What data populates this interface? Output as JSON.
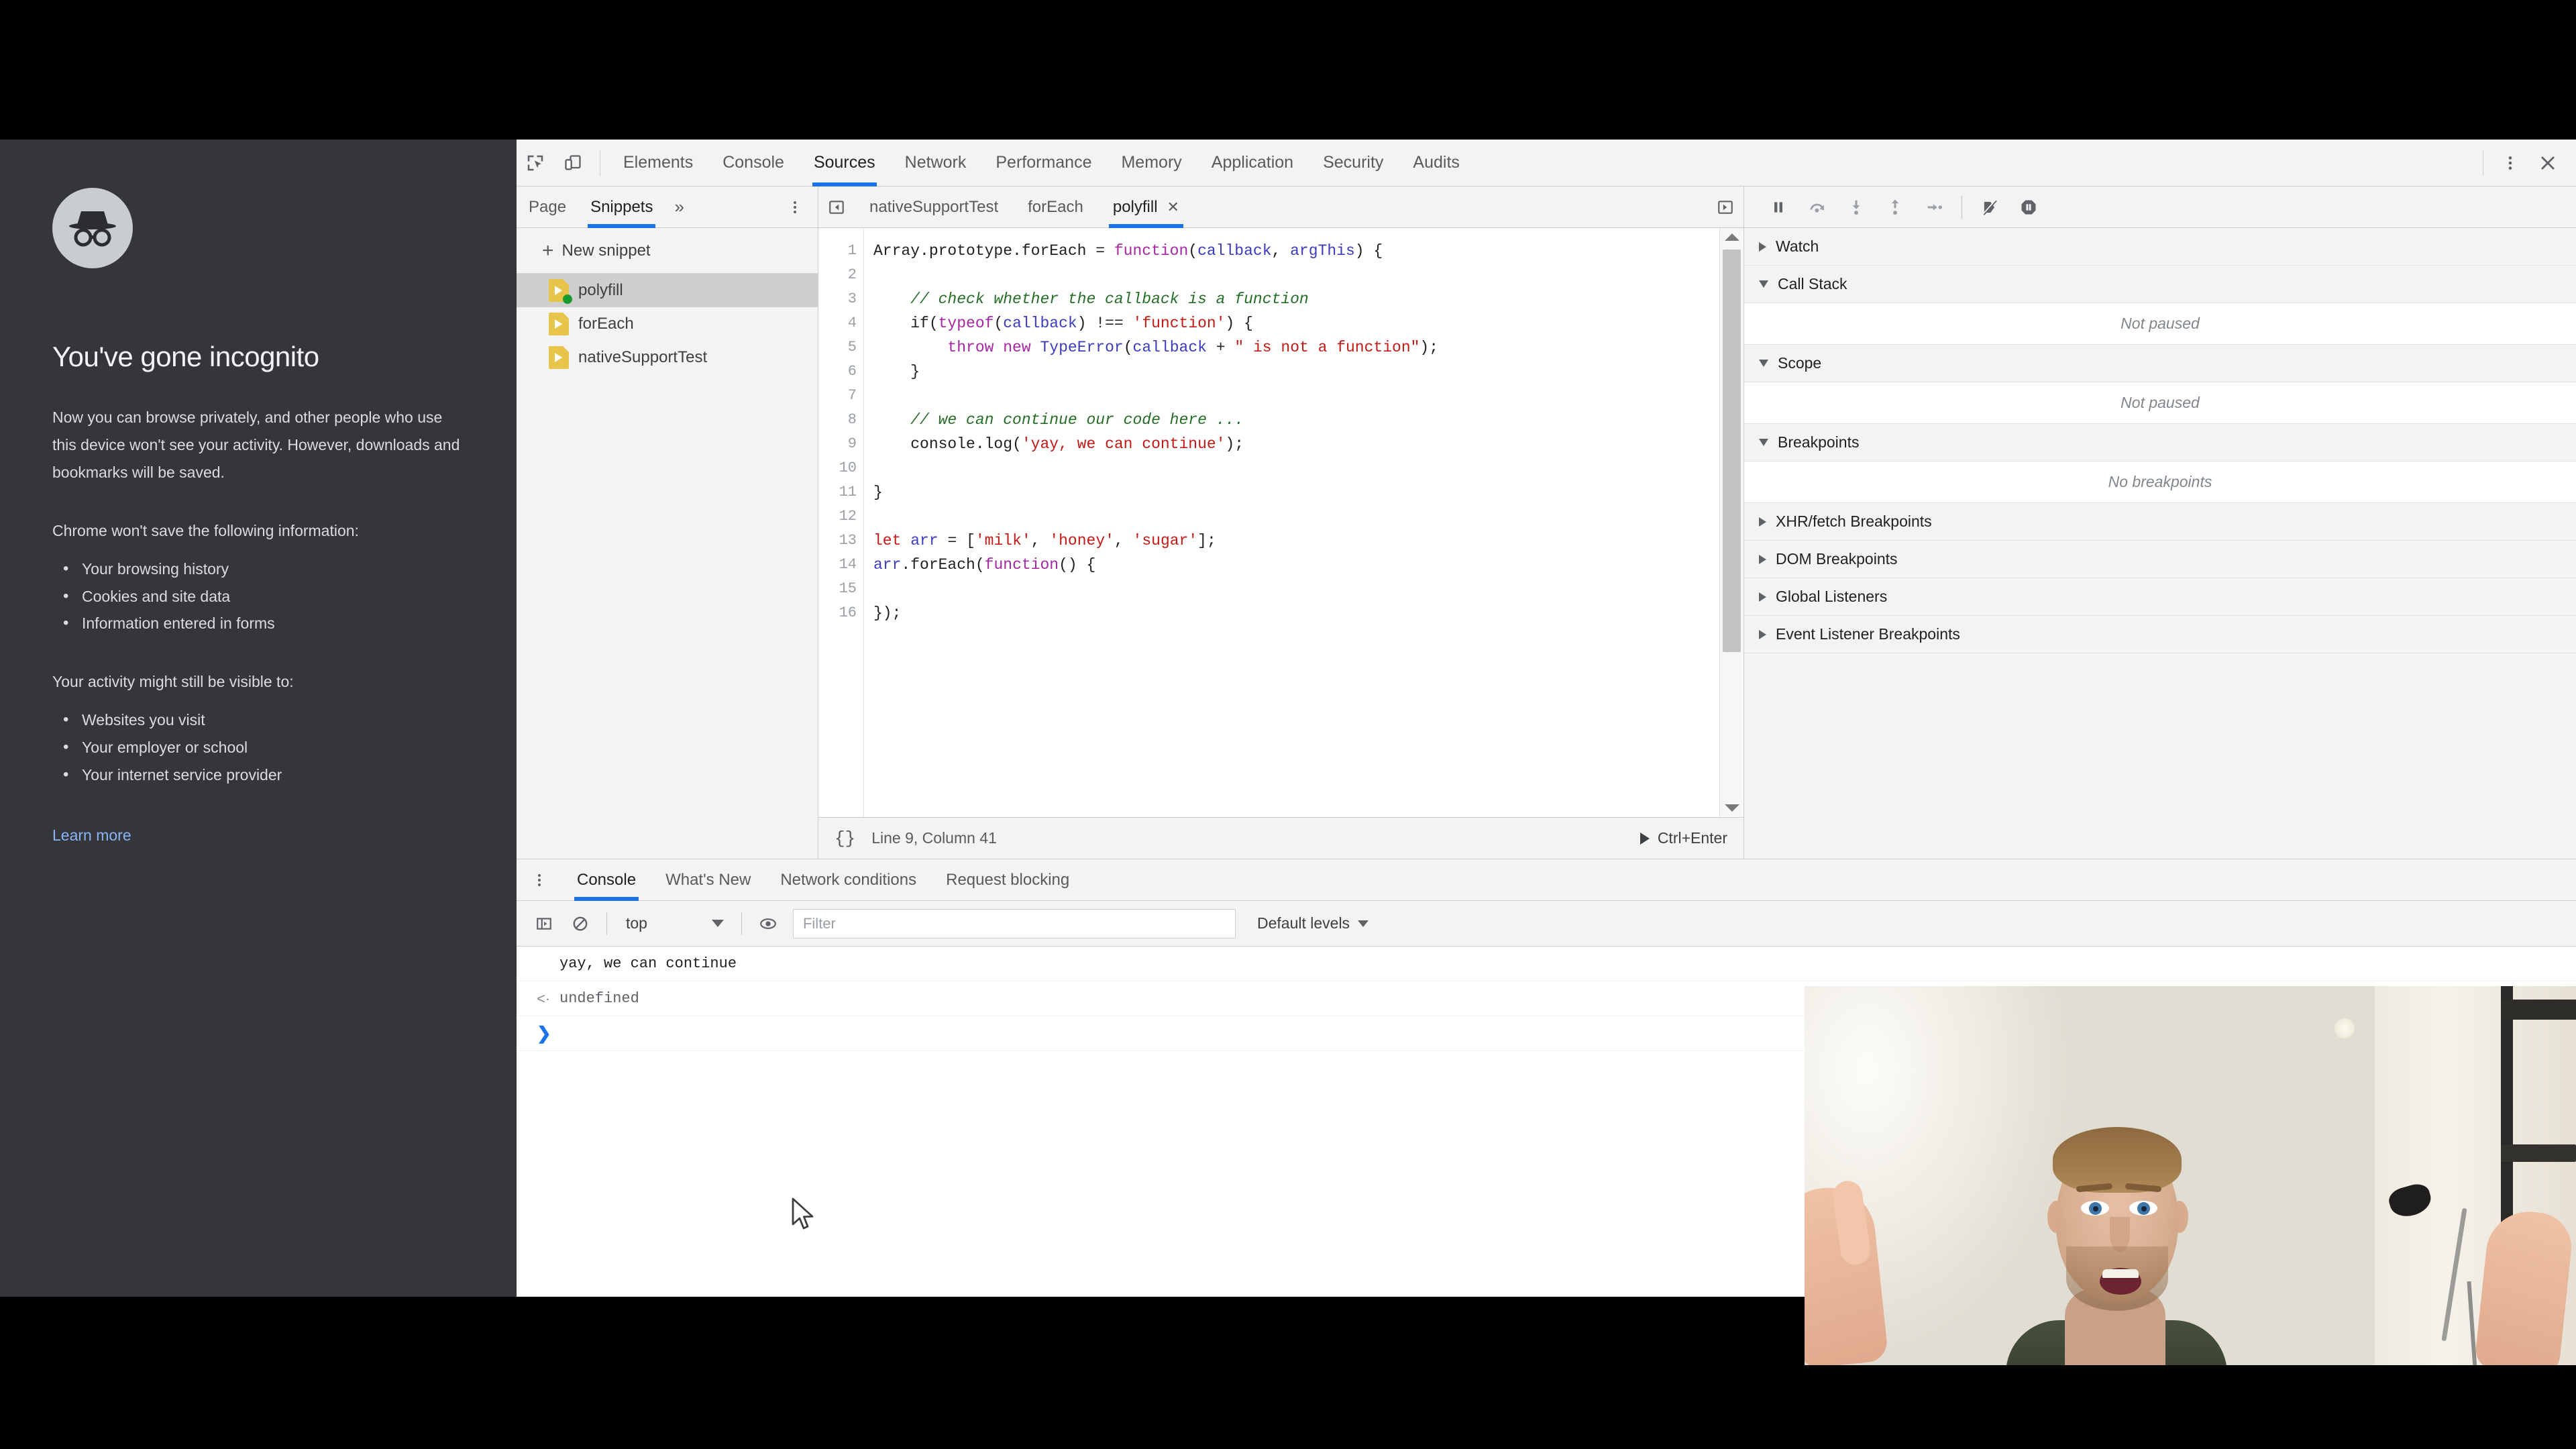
{
  "incognito": {
    "avatar_icon": "incognito-spy-icon",
    "title": "You've gone incognito",
    "paragraph": "Now you can browse privately, and other people who use this device won't see your activity. However, downloads and bookmarks will be saved.",
    "wont_save_heading": "Chrome won't save the following information:",
    "wont_save_items": [
      "Your browsing history",
      "Cookies and site data",
      "Information entered in forms"
    ],
    "visible_heading": "Your activity might still be visible to:",
    "visible_items": [
      "Websites you visit",
      "Your employer or school",
      "Your internet service provider"
    ],
    "learn_more": "Learn more",
    "link_color": "#8ab4f8",
    "background_color": "#35363a"
  },
  "devtools": {
    "accent_color": "#1a73e8",
    "toolbar": {
      "inspect_icon": "inspect-element-icon",
      "device_icon": "device-toolbar-icon",
      "more_icon": "kebab-menu-icon",
      "close_icon": "close-icon",
      "tabs": [
        {
          "label": "Elements",
          "active": false
        },
        {
          "label": "Console",
          "active": false
        },
        {
          "label": "Sources",
          "active": true
        },
        {
          "label": "Network",
          "active": false
        },
        {
          "label": "Performance",
          "active": false
        },
        {
          "label": "Memory",
          "active": false
        },
        {
          "label": "Application",
          "active": false
        },
        {
          "label": "Security",
          "active": false
        },
        {
          "label": "Audits",
          "active": false
        }
      ]
    },
    "navigator": {
      "tabs": [
        {
          "label": "Page",
          "active": false
        },
        {
          "label": "Snippets",
          "active": true
        }
      ],
      "more_tabs_icon": "chevron-double-right-icon",
      "kebab_icon": "kebab-menu-icon",
      "new_snippet_label": "New snippet",
      "new_snippet_icon": "plus-icon",
      "snippets": [
        {
          "name": "polyfill",
          "selected": true,
          "running": true
        },
        {
          "name": "forEach",
          "selected": false,
          "running": false
        },
        {
          "name": "nativeSupportTest",
          "selected": false,
          "running": false
        }
      ]
    },
    "editor": {
      "prev_icon": "panel-collapse-left-icon",
      "next_icon": "panel-collapse-right-icon",
      "tabs": [
        {
          "label": "nativeSupportTest",
          "active": false,
          "closable": false
        },
        {
          "label": "forEach",
          "active": false,
          "closable": false
        },
        {
          "label": "polyfill",
          "active": true,
          "closable": true
        }
      ],
      "close_tab_icon": "close-icon",
      "line_numbers": [
        "1",
        "2",
        "3",
        "4",
        "5",
        "6",
        "7",
        "8",
        "9",
        "10",
        "11",
        "12",
        "13",
        "14",
        "15",
        "16"
      ],
      "code_lines": [
        "Array.prototype.forEach = function(callback, argThis) {",
        "",
        "    // check whether the callback is a function",
        "    if(typeof(callback) !== 'function') {",
        "        throw new TypeError(callback + \" is not a function\");",
        "    }",
        "",
        "    // we can continue our code here ...",
        "    console.log('yay, we can continue');",
        "",
        "}",
        "",
        "let arr = ['milk', 'honey', 'sugar'];",
        "arr.forEach(function() {",
        "",
        "});"
      ],
      "status": {
        "braces_icon": "pretty-print-icon",
        "position": "Line 9, Column 41",
        "run_icon": "play-icon",
        "run_shortcut": "Ctrl+Enter"
      }
    },
    "debugger": {
      "controls": [
        {
          "icon": "pause-icon",
          "name": "pause-script-execution"
        },
        {
          "icon": "step-over-icon",
          "name": "step-over-next-function-call"
        },
        {
          "icon": "step-into-icon",
          "name": "step-into-next-function-call"
        },
        {
          "icon": "step-out-icon",
          "name": "step-out-of-current-function"
        },
        {
          "icon": "step-icon",
          "name": "step"
        },
        {
          "icon": "deactivate-breakpoints-icon",
          "name": "deactivate-breakpoints"
        },
        {
          "icon": "pause-on-exceptions-icon",
          "name": "pause-on-exceptions"
        }
      ],
      "sections": [
        {
          "label": "Watch",
          "expanded": false,
          "empty_text": null
        },
        {
          "label": "Call Stack",
          "expanded": true,
          "empty_text": "Not paused"
        },
        {
          "label": "Scope",
          "expanded": true,
          "empty_text": "Not paused"
        },
        {
          "label": "Breakpoints",
          "expanded": true,
          "empty_text": "No breakpoints"
        },
        {
          "label": "XHR/fetch Breakpoints",
          "expanded": false,
          "empty_text": null
        },
        {
          "label": "DOM Breakpoints",
          "expanded": false,
          "empty_text": null
        },
        {
          "label": "Global Listeners",
          "expanded": false,
          "empty_text": null
        },
        {
          "label": "Event Listener Breakpoints",
          "expanded": false,
          "empty_text": null
        }
      ]
    },
    "drawer": {
      "kebab_icon": "kebab-menu-icon",
      "tabs": [
        {
          "label": "Console",
          "active": true
        },
        {
          "label": "What's New",
          "active": false
        },
        {
          "label": "Network conditions",
          "active": false
        },
        {
          "label": "Request blocking",
          "active": false
        }
      ],
      "console_toolbar": {
        "sidebar_icon": "console-sidebar-icon",
        "clear_icon": "clear-console-icon",
        "context": "top",
        "context_caret_icon": "chevron-down-icon",
        "eye_icon": "live-expression-icon",
        "filter_placeholder": "Filter",
        "filter_value": "",
        "levels_label": "Default levels",
        "levels_caret_icon": "chevron-down-icon"
      },
      "console_rows": [
        {
          "type": "log",
          "marker": "",
          "text": "yay, we can continue"
        },
        {
          "type": "result",
          "marker": "<·",
          "text": "undefined"
        },
        {
          "type": "prompt",
          "marker": "❯",
          "text": ""
        }
      ]
    }
  }
}
